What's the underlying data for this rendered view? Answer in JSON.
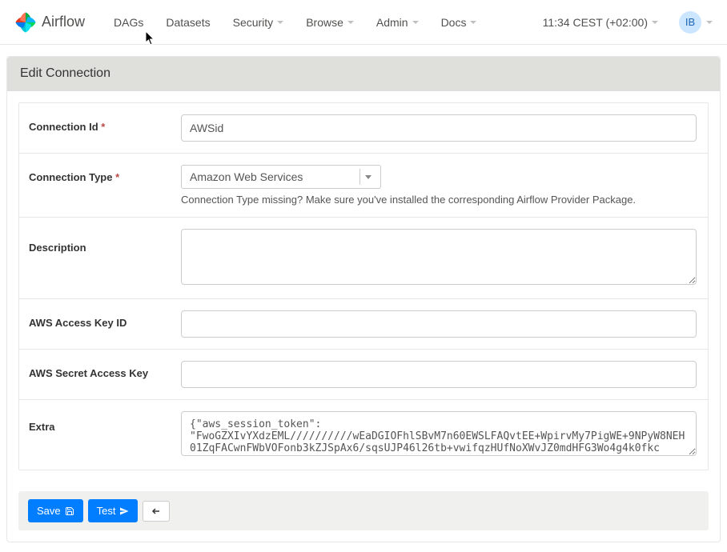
{
  "brand": {
    "name": "Airflow"
  },
  "nav": {
    "dags": "DAGs",
    "datasets": "Datasets",
    "security": "Security",
    "browse": "Browse",
    "admin": "Admin",
    "docs": "Docs",
    "time": "11:34 CEST (+02:00)",
    "user_initials": "IB"
  },
  "panel": {
    "title": "Edit Connection"
  },
  "form": {
    "conn_id": {
      "label": "Connection Id",
      "value": "AWSid"
    },
    "conn_type": {
      "label": "Connection Type",
      "value": "Amazon Web Services",
      "help": "Connection Type missing? Make sure you've installed the corresponding Airflow Provider Package."
    },
    "description": {
      "label": "Description",
      "value": ""
    },
    "aws_access_key_id": {
      "label": "AWS Access Key ID",
      "value": ""
    },
    "aws_secret_access_key": {
      "label": "AWS Secret Access Key",
      "value": ""
    },
    "extra": {
      "label": "Extra",
      "value": "{\"aws_session_token\": \"FwoGZXIvYXdzEML//////////wEaDGIOFhlSBvM7n60EWSLFAQvtEE+WpirvMy7PigWE+9NPyW8NEH01ZqFACwnFWbVOFonb3kZJSpAx6/sqsUJP46l26tb+vwifqzHUfNoXWvJZ0mdHFG3Wo4g4k0fkc"
    }
  },
  "actions": {
    "save": "Save",
    "test": "Test"
  }
}
